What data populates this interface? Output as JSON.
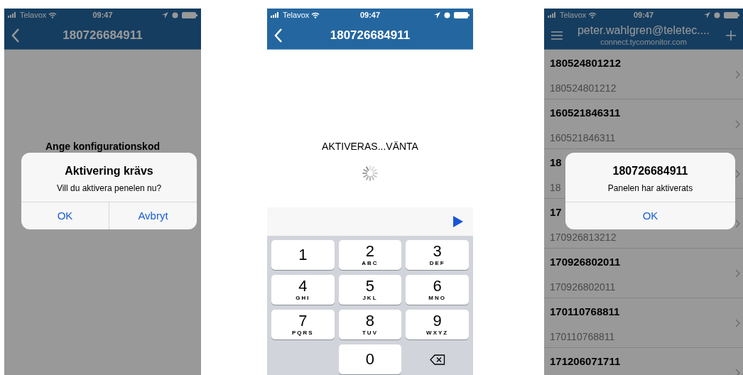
{
  "screens": [
    {
      "kind": "alert_form",
      "dimmed": true,
      "status_bar": {
        "carrier": "Telavox",
        "time": "09:47"
      },
      "nav": {
        "title": "180726684911",
        "kind": "back"
      },
      "prompt": "Ange konfigurationskod",
      "alert": {
        "title": "Aktivering krävs",
        "message": "Vill du aktivera penelen nu?",
        "buttons": [
          "OK",
          "Avbryt"
        ]
      }
    },
    {
      "kind": "activating",
      "dimmed": false,
      "status_bar": {
        "carrier": "Telavox",
        "time": "09:47"
      },
      "nav": {
        "title": "180726684911",
        "kind": "back"
      },
      "status_text": "AKTIVERAS...VÄNTA",
      "keypad": [
        {
          "kind": "digit",
          "digit": "1"
        },
        {
          "kind": "digit",
          "digit": "2",
          "letters": "ABC"
        },
        {
          "kind": "digit",
          "digit": "3",
          "letters": "DEF"
        },
        {
          "kind": "digit",
          "digit": "4",
          "letters": "GHI"
        },
        {
          "kind": "digit",
          "digit": "5",
          "letters": "JKL"
        },
        {
          "kind": "digit",
          "digit": "6",
          "letters": "MNO"
        },
        {
          "kind": "digit",
          "digit": "7",
          "letters": "PQRS"
        },
        {
          "kind": "digit",
          "digit": "8",
          "letters": "TUV"
        },
        {
          "kind": "digit",
          "digit": "9",
          "letters": "WXYZ"
        },
        {
          "kind": "empty"
        },
        {
          "kind": "digit",
          "digit": "0"
        },
        {
          "kind": "backspace"
        }
      ]
    },
    {
      "kind": "list",
      "dimmed": true,
      "status_bar": {
        "carrier": "Telavox",
        "time": "09:47"
      },
      "nav": {
        "title": "peter.wahlgren@teletec....",
        "subtitle": "connect.tycomonitor.com",
        "kind": "menu"
      },
      "rows": [
        {
          "title": "180524801212",
          "subtitle": "180524801212"
        },
        {
          "title": "160521846311",
          "subtitle": "160521846311"
        },
        {
          "title": "18",
          "subtitle": "18"
        },
        {
          "title": "17",
          "subtitle": "170926813212"
        },
        {
          "title": "170926802011",
          "subtitle": "170926802011"
        },
        {
          "title": "170110768811",
          "subtitle": "170110768811"
        },
        {
          "title": "171206071711"
        }
      ],
      "alert": {
        "title": "180726684911",
        "message": "Panelen har aktiverats",
        "buttons": [
          "OK"
        ]
      }
    }
  ]
}
